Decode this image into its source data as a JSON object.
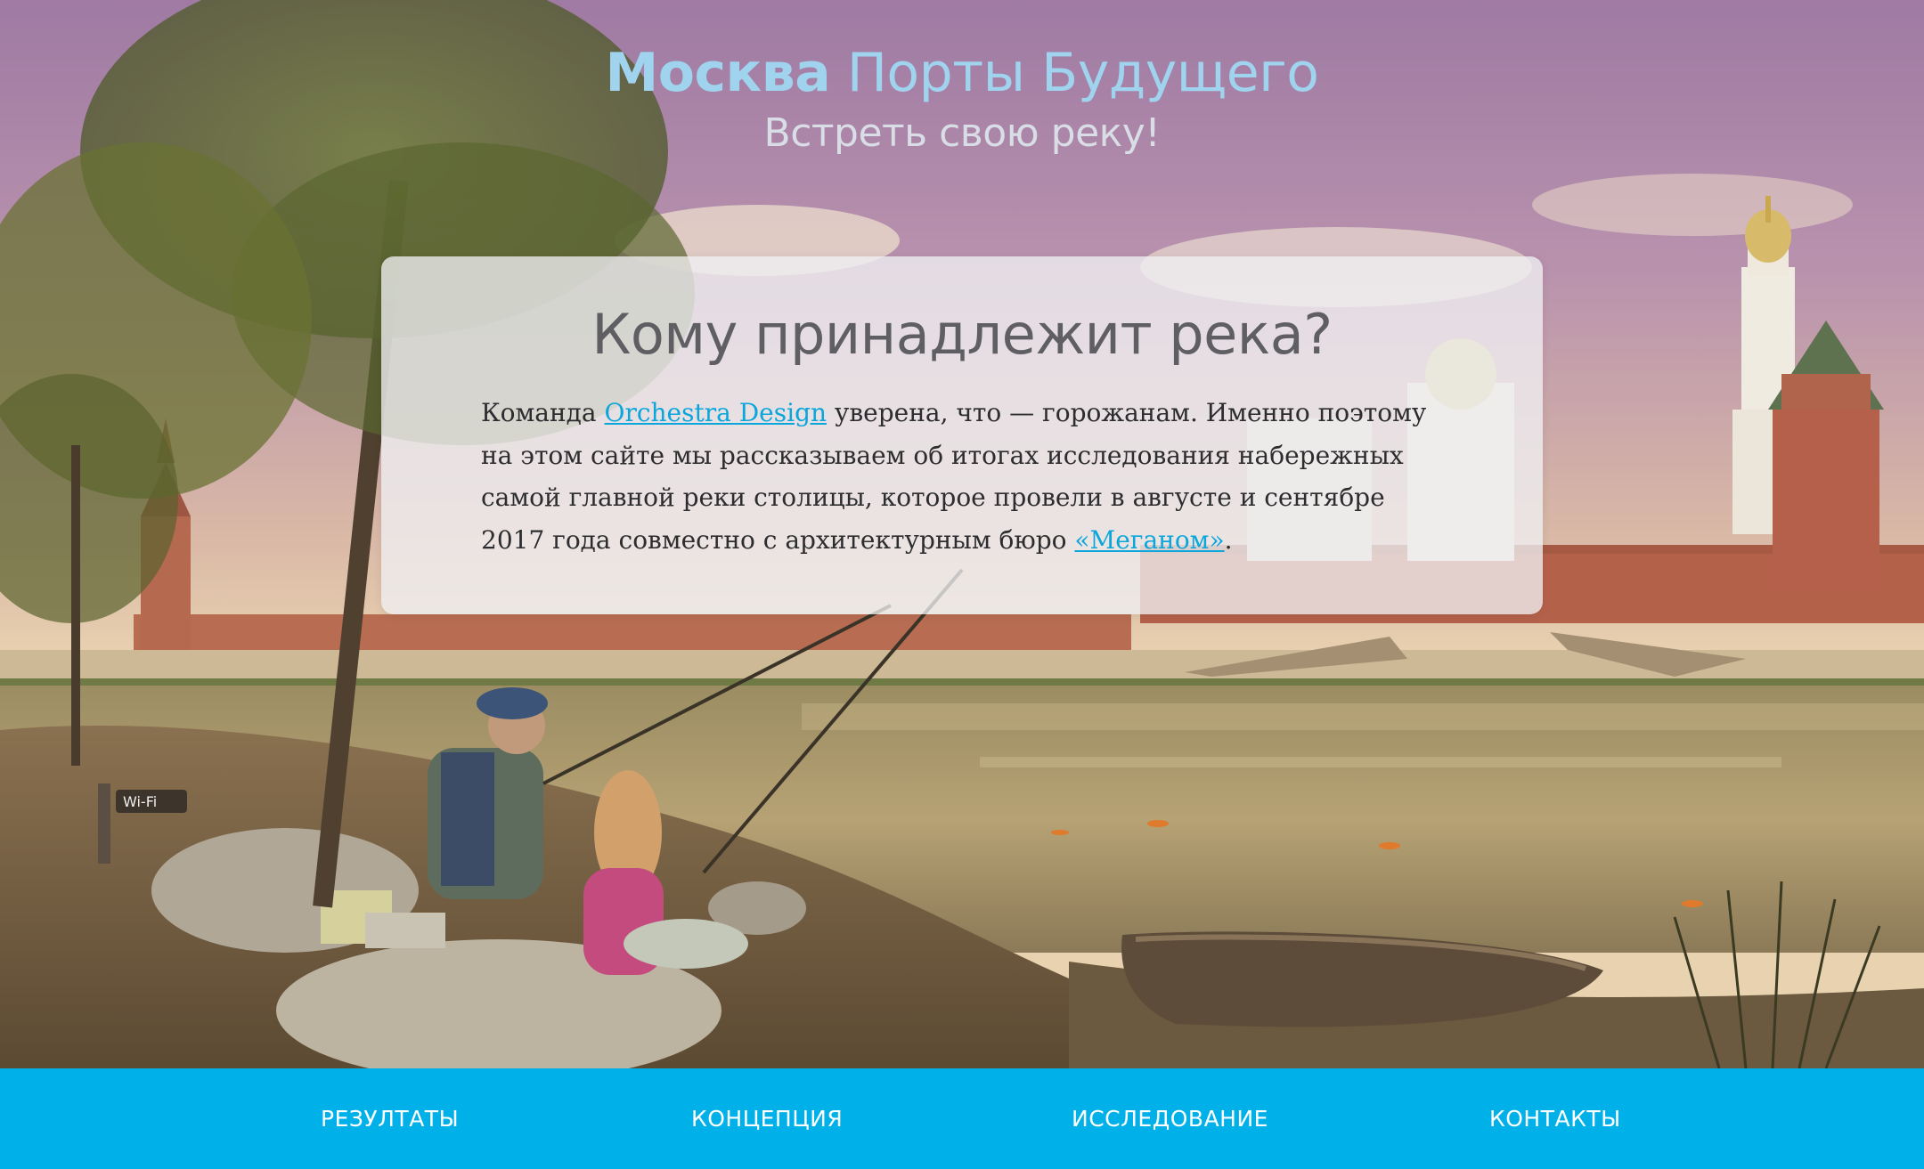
{
  "header": {
    "title_bold": "Москва",
    "title_rest": "Порты Будущего",
    "subtitle": "Встреть свою реку!"
  },
  "card": {
    "heading": "Кому принадлежит река?",
    "text_1": "Команда ",
    "link_1": "Orchestra Design",
    "text_2": " уверена, что — горожанам. Именно поэтому на этом сайте мы рассказываем об итогах исследования набережных самой главной реки столицы, которое провели в августе и сентябре 2017 года совместно с архитектурным бюро ",
    "link_2": "«Меганом»",
    "text_3": "."
  },
  "scene": {
    "wifi_sign": "Wi-Fi"
  },
  "nav": {
    "items": [
      "РЕЗУЛТАТЫ",
      "КОНЦЕПЦИЯ",
      "ИССЛЕДОВАНИЕ",
      "КОНТАКТЫ"
    ]
  },
  "colors": {
    "accent": "#00b0e8",
    "title": "#9fd3ee",
    "link": "#0aa6dc",
    "sky": "#a17da4"
  }
}
